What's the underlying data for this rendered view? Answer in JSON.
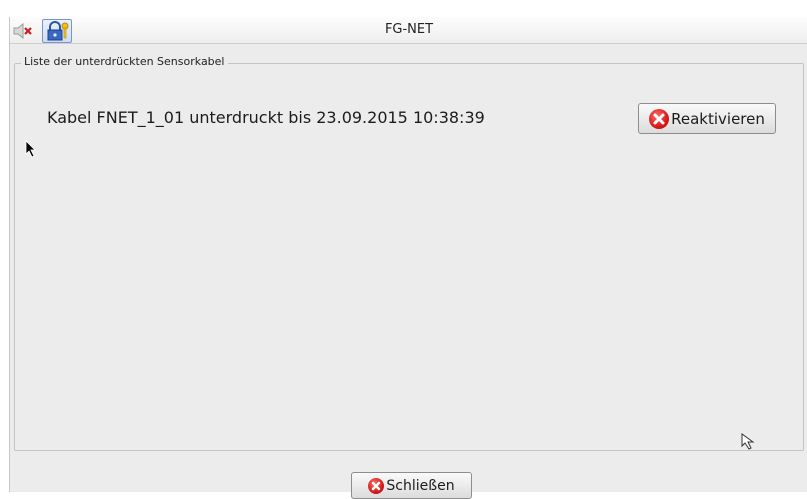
{
  "window": {
    "title": "FG-NET"
  },
  "group": {
    "label": "Liste der unterdrückten Sensorkabel",
    "entries": [
      {
        "text": "Kabel FNET_1_01 unterdruckt bis 23.09.2015 10:38:39",
        "button_label": "Reaktivieren"
      }
    ]
  },
  "footer": {
    "close_label": "Schließen"
  },
  "icons": {
    "speaker": "speaker-muted-icon",
    "lock": "lock-key-icon",
    "error": "error-x-icon"
  },
  "colors": {
    "error_red": "#d71a1a",
    "window_bg": "#ececec"
  }
}
